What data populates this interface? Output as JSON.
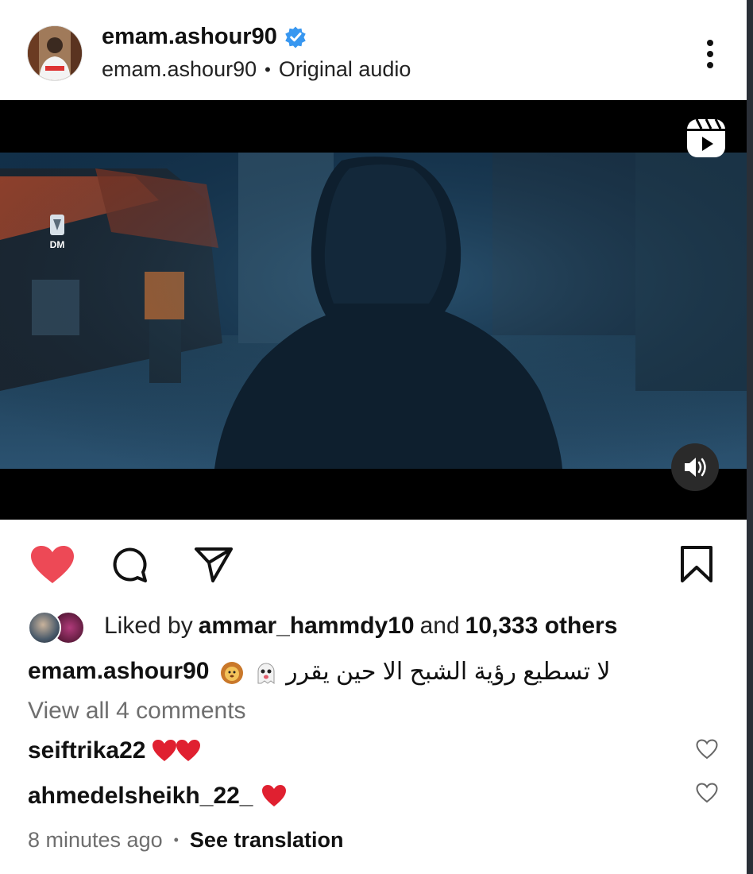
{
  "post": {
    "username": "emam.ashour90",
    "sub_username": "emam.ashour90",
    "sub_separator": "•",
    "audio_label": "Original audio",
    "video_watermark": "DM"
  },
  "likes": {
    "prefix": "Liked by",
    "user": "ammar_hammdy10",
    "conjunction": "and",
    "count": "10,333 others"
  },
  "caption": {
    "username": "emam.ashour90",
    "text": "لا تسطيع رؤية الشبح الا حين يقرر"
  },
  "view_all": "View all 4 comments",
  "comments": [
    {
      "username": "seiftrika22"
    },
    {
      "username": "ahmedelsheikh_22_"
    }
  ],
  "meta": {
    "time": "8 minutes ago",
    "separator": "•",
    "translate": "See translation"
  },
  "colors": {
    "like_red": "#ed4956",
    "verified_blue": "#3897f0",
    "secondary_text": "#6e6e6e"
  }
}
